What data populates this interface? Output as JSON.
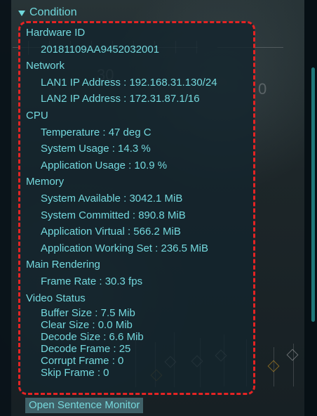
{
  "condition": {
    "title": "Condition",
    "icon": "triangle-down-icon"
  },
  "sections": {
    "hardware": {
      "title": "Hardware ID",
      "id": "20181109AA9452032001"
    },
    "network": {
      "title": "Network",
      "lan1": "LAN1 IP Address : 192.168.31.130/24",
      "lan2": "LAN2 IP Address : 172.31.87.1/16"
    },
    "cpu": {
      "title": "CPU",
      "temperature": "Temperature : 47 deg C",
      "system_usage": "System Usage : 14.3 %",
      "application_usage": "Application Usage : 10.9 %"
    },
    "memory": {
      "title": "Memory",
      "system_available": "System Available : 3042.1 MiB",
      "system_committed": "System Committed : 890.8 MiB",
      "application_virtual": "Application Virtual : 566.2 MiB",
      "application_working_set": "Application Working Set : 236.5 MiB"
    },
    "main_rendering": {
      "title": "Main Rendering",
      "frame_rate": "Frame Rate : 30.3 fps"
    },
    "video_status": {
      "title": "Video Status",
      "buffer_size": "Buffer Size : 7.5 Mib",
      "clear_size": "Clear Size : 0.0 Mib",
      "decode_size": "Decode Size : 6.6 Mib",
      "decode_frame": "Decode Frame : 25",
      "corrupt_frame": "Corrupt Frame : 0",
      "skip_frame": "Skip Frame : 0"
    }
  },
  "footer": {
    "button_label": "Open Sentence Monitor"
  },
  "colors": {
    "accent": "#74D9DE",
    "outline": "#E52323"
  }
}
